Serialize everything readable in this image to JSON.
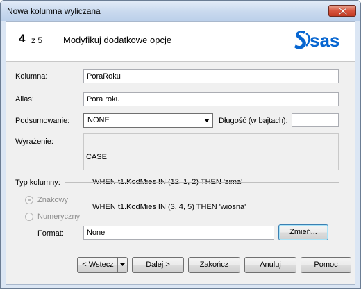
{
  "window": {
    "title": "Nowa kolumna wyliczana"
  },
  "header": {
    "step_number": "4",
    "step_of": "z 5",
    "step_title": "Modyfikuj dodatkowe opcje",
    "logo_text": "sas"
  },
  "form": {
    "column_label": "Kolumna:",
    "column_value": "PoraRoku",
    "alias_label": "Alias:",
    "alias_value": "Pora roku",
    "summary_label": "Podsumowanie:",
    "summary_value": "NONE",
    "length_label": "Długość (w bajtach):",
    "length_value": "",
    "expression_label": "Wyrażenie:",
    "expression_lines": [
      "CASE",
      "   WHEN t1.KodMies IN (12, 1, 2) THEN 'zima'",
      "   WHEN t1.KodMies IN (3, 4, 5) THEN 'wiosna'"
    ],
    "column_type_label": "Typ kolumny:",
    "type_options": [
      {
        "label": "Znakowy",
        "selected": true,
        "enabled": false
      },
      {
        "label": "Numeryczny",
        "selected": false,
        "enabled": false
      }
    ],
    "format_label": "Format:",
    "format_value": "None",
    "change_button": "Zmień..."
  },
  "buttons": {
    "back": "< Wstecz",
    "next": "Dalej >",
    "finish": "Zakończ",
    "cancel": "Anuluj",
    "help": "Pomoc"
  },
  "colors": {
    "logo_blue": "#0766d1",
    "titlebar": "#c9d9ee",
    "close_red": "#c23a22"
  },
  "icons": [
    "close-icon",
    "dropdown-arrow-icon",
    "sas-logo"
  ]
}
